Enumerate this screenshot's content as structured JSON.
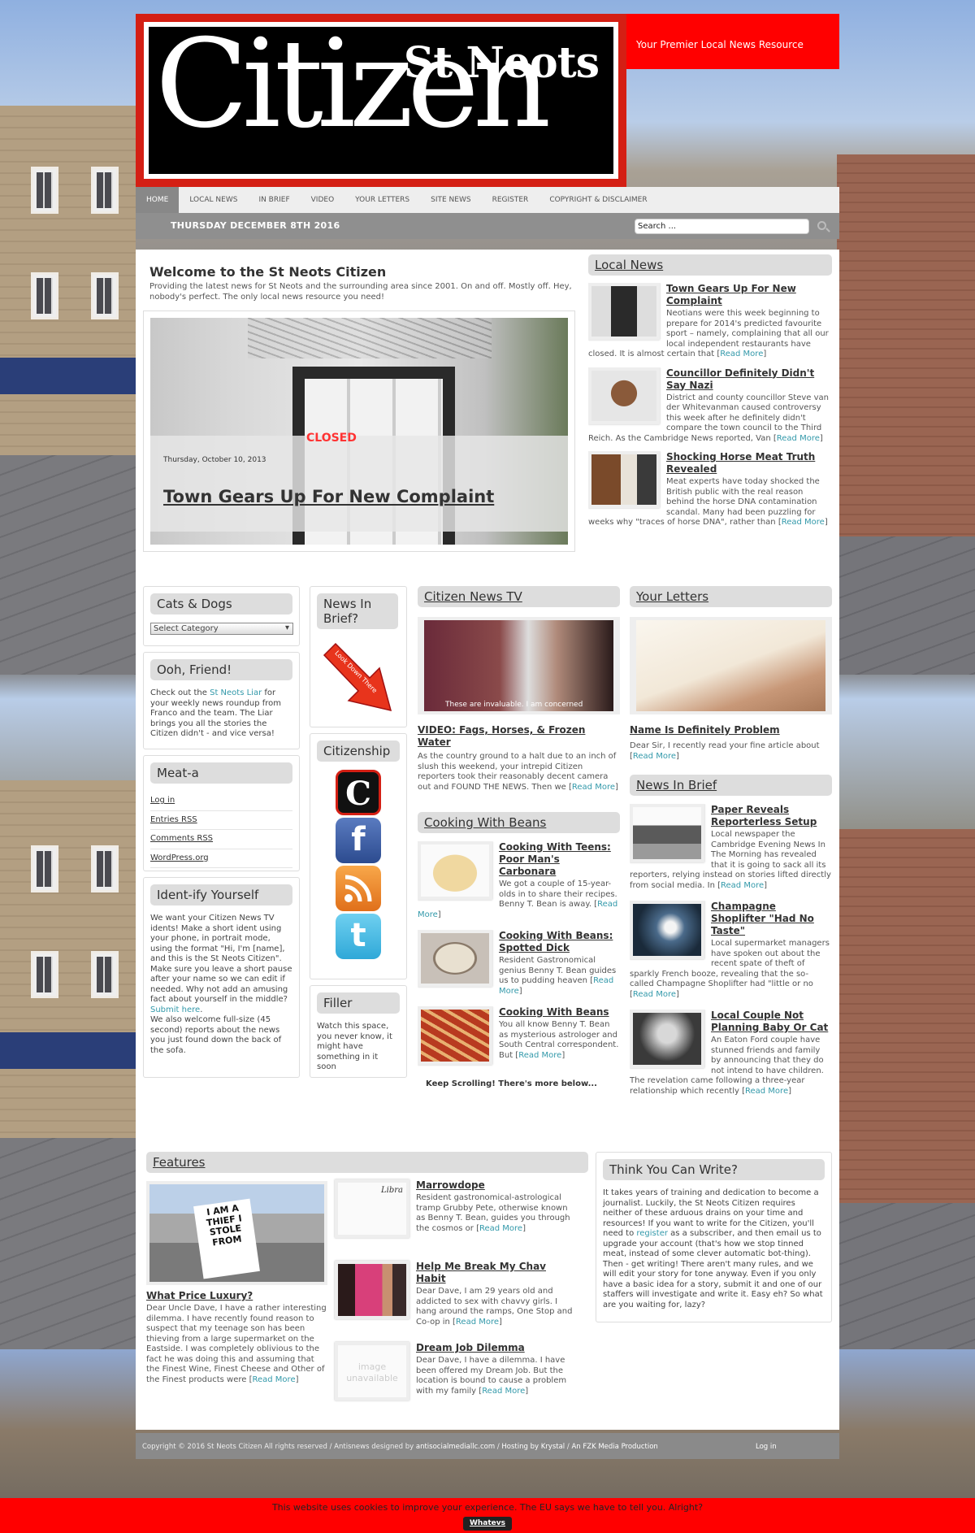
{
  "header": {
    "logo_top": "St Neots",
    "logo_main": "Citizen",
    "tagline": "Your Premier Local News Resource"
  },
  "nav": [
    "HOME",
    "LOCAL NEWS",
    "IN BRIEF",
    "VIDEO",
    "YOUR LETTERS",
    "SITE NEWS",
    "REGISTER",
    "COPYRIGHT & DISCLAIMER"
  ],
  "date": "THURSDAY DECEMBER 8TH 2016",
  "search": {
    "value": "Search ..."
  },
  "welcome": {
    "title": "Welcome to the St Neots Citizen",
    "text": "Providing the latest news for St Neots and the surrounding area since 2001. On and off. Mostly off. Hey, nobody's perfect. The only local news resource you need!"
  },
  "slider": {
    "date": "Thursday, October 10, 2013",
    "title": "Town Gears Up For New Complaint",
    "sign": "CLOSED"
  },
  "local_news": {
    "heading": "Local News",
    "items": [
      {
        "title": "Town Gears Up For New Complaint",
        "text": "Neotians were this week beginning to prepare for 2014's predicted favourite sport – namely, complaining that all our local independent restaurants have closed. It is almost certain that [",
        "more": "Read More",
        "end": "]"
      },
      {
        "title": "Councillor Definitely Didn't Say Nazi",
        "text": "District and county councillor Steve van der Whitevanman caused controversy this week after he definitely didn't compare the town council to the Third Reich. As the Cambridge News reported, Van [",
        "more": "Read More",
        "end": "]"
      },
      {
        "title": "Shocking Horse Meat Truth Revealed",
        "text": "Meat experts have today shocked the British public with the real reason behind the horse DNA contamination scandal. Many had been puzzling for weeks why \"traces of horse DNA\", rather than [",
        "more": "Read More",
        "end": "]"
      }
    ]
  },
  "cats": {
    "heading": "Cats & Dogs",
    "select": "Select Category"
  },
  "friend": {
    "heading": "Ooh, Friend!",
    "t1": "Check out the ",
    "link": "St Neots Liar",
    "t2": " for your weekly news roundup from Franco and the team. The Liar brings you all the stories the Citizen didn't - and vice versa!"
  },
  "meta": {
    "heading": "Meat-a",
    "links": [
      "Log in",
      "Entries RSS",
      "Comments RSS",
      "WordPress.org"
    ]
  },
  "ident": {
    "heading": "Ident-ify Yourself",
    "t1": "We want your Citizen News TV idents! Make a short ident using your phone, in portrait mode, using the format \"Hi, I'm [name], and this is the St Neots Citizen\". Make sure you leave a short pause after your name so we can edit if needed. Why not add an amusing fact about yourself in the middle? ",
    "link": "Submit here",
    "t2": ".",
    "t3": "We also welcome full-size (45 second) reports about the news you just found down the back of the sofa."
  },
  "brief_box": {
    "heading": "News In Brief?",
    "arrow": "Look Down There"
  },
  "citizenship": {
    "heading": "Citizenship",
    "icons": [
      "citizen-icon",
      "facebook-icon",
      "rss-icon",
      "twitter-icon"
    ]
  },
  "filler": {
    "heading": "Filler",
    "text": "Watch this space, you never know, it might have something in it soon"
  },
  "tv": {
    "heading": "Citizen News TV",
    "subtitle": "These are invaluable. I am concerned",
    "title": "VIDEO: Fags, Horses, & Frozen Water",
    "text": "As the country ground to a halt due to an inch of slush this weekend, your intrepid Citizen reporters took their reasonably decent camera out and FOUND THE NEWS. Then we [",
    "more": "Read More",
    "end": "]"
  },
  "beans": {
    "heading": "Cooking With Beans",
    "items": [
      {
        "title": "Cooking With Teens: Poor Man's Carbonara",
        "text": "We got a couple of 15-year-olds in to share their recipes. Benny T. Bean is away. [",
        "more": "Read More",
        "end": "]"
      },
      {
        "title": "Cooking With Beans: Spotted Dick",
        "text": "Resident Gastronomical genius Benny T. Bean guides us to pudding heaven [",
        "more": "Read More",
        "end": "]"
      },
      {
        "title": "Cooking With Beans",
        "text": "You all know Benny T. Bean as mysterious astrologer and South Central correspondent. But [",
        "more": "Read More",
        "end": "]"
      }
    ],
    "scroll": "Keep Scrolling! There's more below..."
  },
  "letters": {
    "heading": "Your Letters",
    "title": "Name Is Definitely Problem",
    "text": "Dear Sir, I recently read your fine article about [",
    "more": "Read More",
    "end": "]"
  },
  "brief": {
    "heading": "News In Brief",
    "items": [
      {
        "title": "Paper Reveals Reporterless Setup",
        "text": "Local newspaper the Cambridge Evening News In The Morning has revealed that it is going to sack all its reporters, relying instead on stories lifted directly from social media. In [",
        "more": "Read More",
        "end": "]"
      },
      {
        "title": "Champagne Shoplifter \"Had No Taste\"",
        "text": "Local supermarket managers have spoken out about the recent spate of theft of sparkly French booze, revealing that the so-called Champagne Shoplifter had \"little or no [",
        "more": "Read More",
        "end": "]"
      },
      {
        "title": "Local Couple Not Planning Baby Or Cat",
        "text": "An Eaton Ford couple have stunned friends and family by announcing that they do not intend to have children. The revelation came following a three-year relationship which recently [",
        "more": "Read More",
        "end": "]"
      }
    ]
  },
  "features": {
    "heading": "Features",
    "sign": "I AM A THIEF I STOLE FROM",
    "main": {
      "title": "What Price Luxury?",
      "text": "Dear Uncle Dave, I have a rather interesting dilemma. I have recently found reason to suspect that my teenage son has been thieving from a large supermarket on the Eastside. I was completely oblivious to the fact he was doing this and assuming that the Finest Wine, Finest Cheese and Other of the Finest products were [",
      "more": "Read More",
      "end": "]"
    },
    "items": [
      {
        "title": "Marrowdope",
        "text": "Resident gastronomical-astrological tramp Grubby Pete, otherwise known as Benny T. Bean, guides you through the cosmos or [",
        "more": "Read More",
        "end": "]",
        "thumb": "Libra"
      },
      {
        "title": "Help Me Break My Chav Habit",
        "text": "Dear Dave, I am 29 years old and addicted to sex with chavvy girls. I hang around the ramps, One Stop and Co-op in [",
        "more": "Read More",
        "end": "]"
      },
      {
        "title": "Dream Job Dilemma",
        "text": "Dear Dave, I have a dilemma. I have been offered my Dream Job. But the location is bound to cause a problem with my family [",
        "more": "Read More",
        "end": "]",
        "thumb": "image unavailable"
      }
    ]
  },
  "write": {
    "heading": "Think You Can Write?",
    "t1": "It takes years of training and dedication to become a journalist. Luckily, the St Neots Citizen requires neither of these arduous drains on your time and resources! If you want to write for the Citizen, you'll need to ",
    "link": "register",
    "t2": " as a subscriber, and then email us to upgrade your account (that's how we stop tinned meat, instead of some clever automatic bot-thing). Then - get writing! There aren't many rules, and we will edit your story for tone anyway. Even if you only have a basic idea for a story, submit it and one of our staffers will investigate and write it. Easy eh? So what are you waiting for, lazy?"
  },
  "footer": {
    "t1": "Copyright © 2016 St Neots Citizen All rights reserved / Antisnews designed by ",
    "l1": "antisocialmediallc.com",
    "s1": " / ",
    "l2": "Hosting by Krystal",
    "s2": " / ",
    "l3": "An FZK Media Production",
    "login": "Log in"
  },
  "cookie": {
    "text": "This website uses cookies to improve your experience. The EU says we have to tell you. Alright?",
    "button": "Whatevs"
  }
}
